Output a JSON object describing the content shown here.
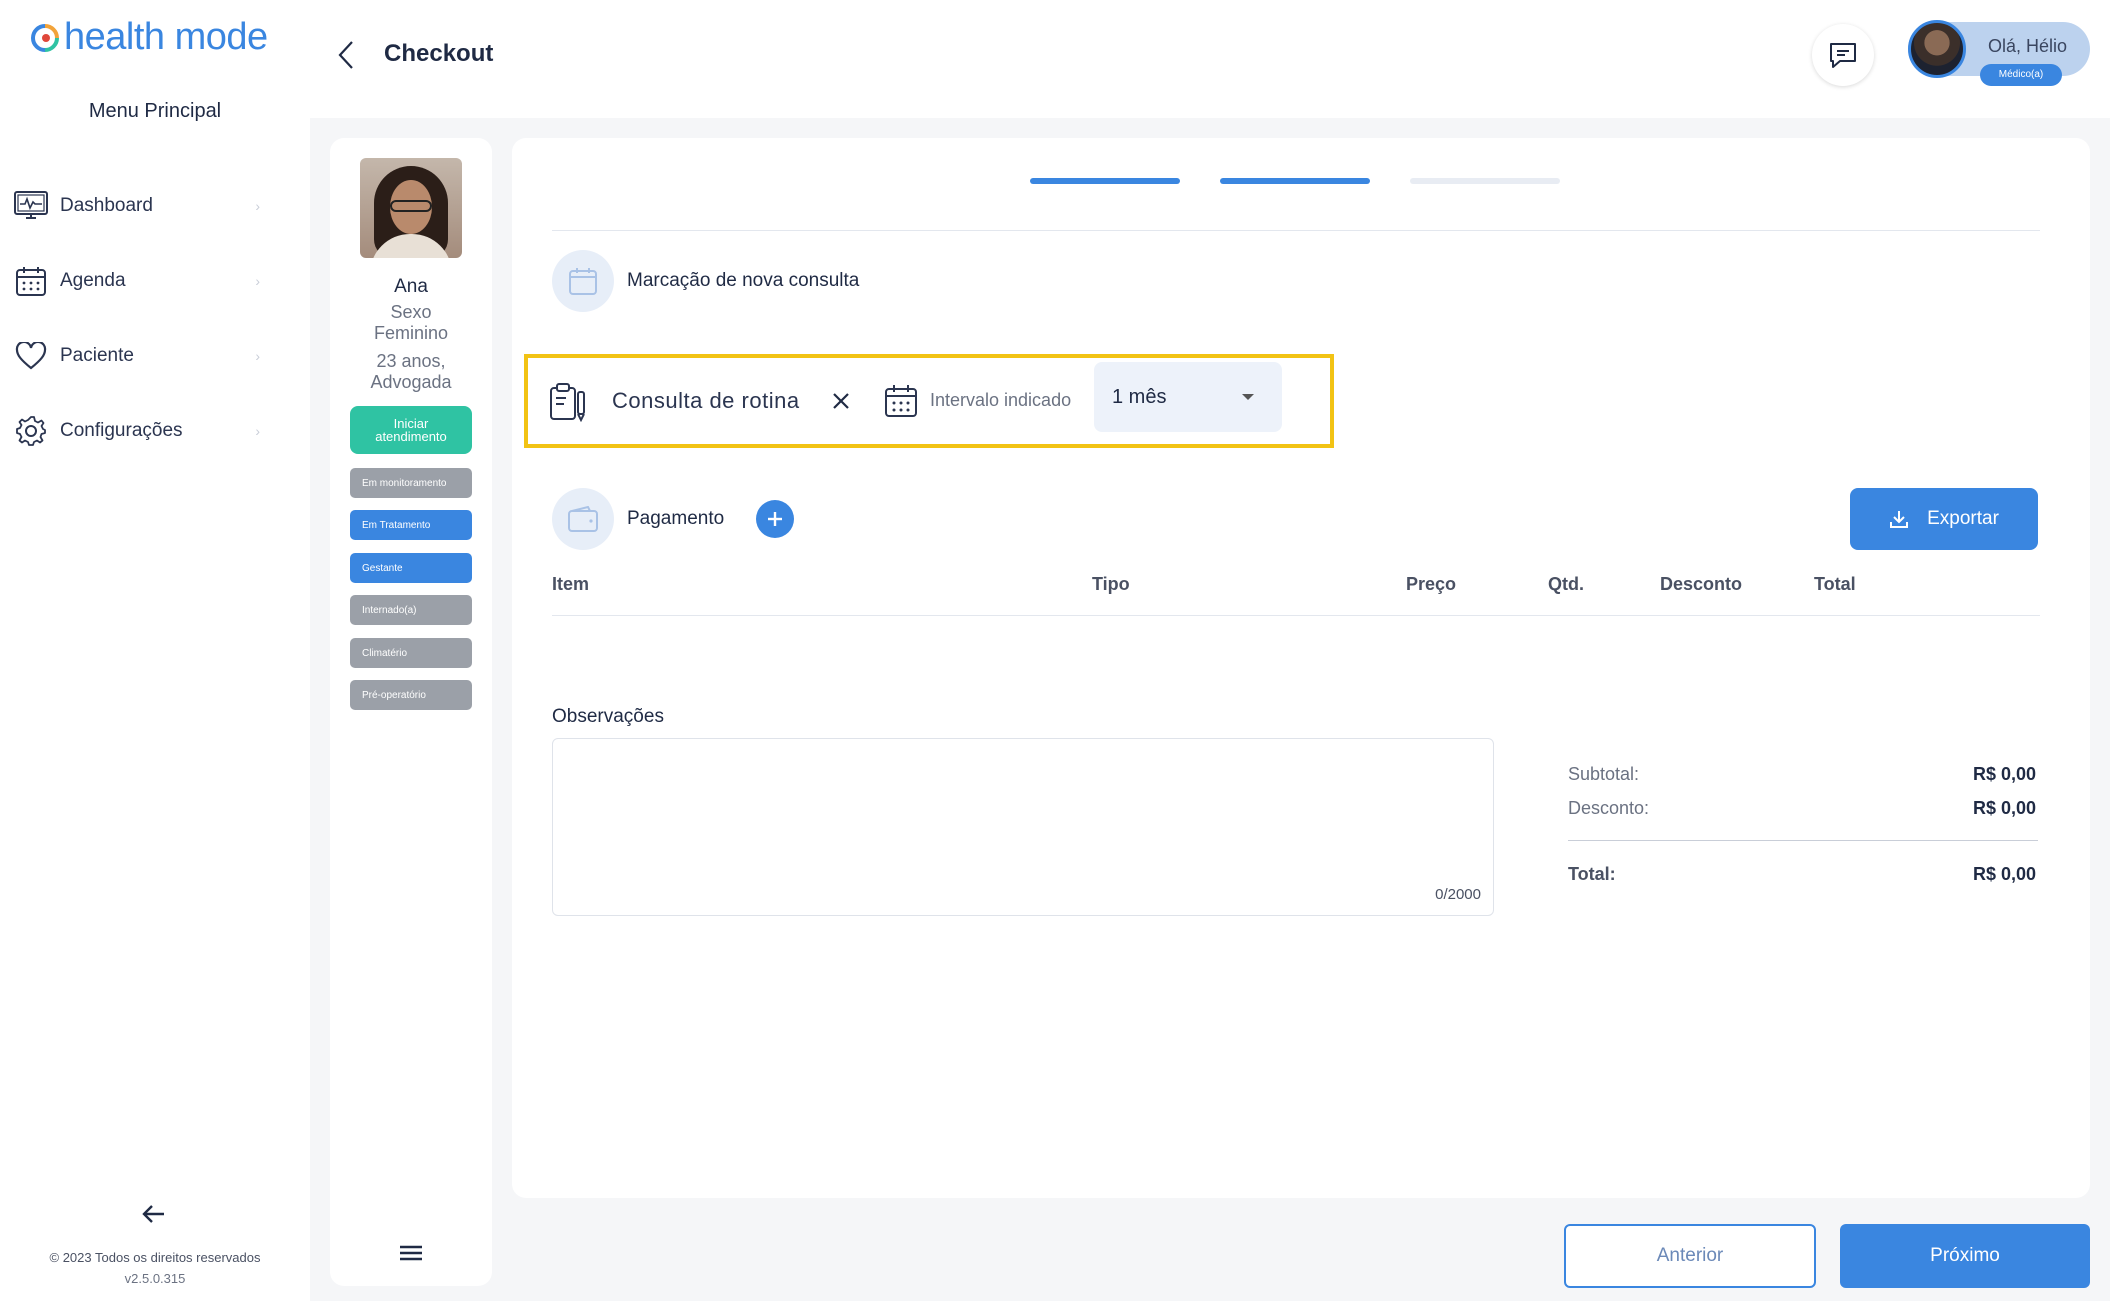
{
  "brand": {
    "name": "health mode",
    "accent": "#3a86e0"
  },
  "sidebar": {
    "menu_title": "Menu Principal",
    "items": [
      {
        "label": "Dashboard",
        "icon": "monitor-icon"
      },
      {
        "label": "Agenda",
        "icon": "calendar-icon"
      },
      {
        "label": "Paciente",
        "icon": "heart-icon"
      },
      {
        "label": "Configurações",
        "icon": "gear-icon"
      }
    ],
    "footer_copyright": "© 2023 Todos os direitos reservados",
    "footer_version": "v2.5.0.315"
  },
  "header": {
    "title": "Checkout",
    "user_greeting": "Olá, Hélio",
    "user_role": "Médico(a)"
  },
  "patient": {
    "name": "Ana",
    "sex_line1": "Sexo",
    "sex_line2": "Feminino",
    "age_line1": "23 anos,",
    "age_line2": "Advogada",
    "start_button": "Iniciar atendimento",
    "tags": [
      {
        "label": "Em monitoramento",
        "color": "#9ba0a8"
      },
      {
        "label": "Em Tratamento",
        "color": "#3a86e0"
      },
      {
        "label": "Gestante",
        "color": "#3a86e0"
      },
      {
        "label": "Internado(a)",
        "color": "#9ba0a8"
      },
      {
        "label": "Climatério",
        "color": "#9ba0a8"
      },
      {
        "label": "Pré-operatório",
        "color": "#9ba0a8"
      }
    ]
  },
  "checkout": {
    "steps_completed": 2,
    "steps_total": 3,
    "new_appointment_title": "Marcação de nova consulta",
    "consultation_type": "Consulta de rotina",
    "interval_label": "Intervalo indicado",
    "interval_value": "1 mês",
    "payment_title": "Pagamento",
    "export_button": "Exportar",
    "table_headers": [
      "Item",
      "Tipo",
      "Preço",
      "Qtd.",
      "Desconto",
      "Total"
    ],
    "observations_label": "Observações",
    "observations_counter": "0/2000",
    "subtotal_label": "Subtotal:",
    "subtotal_value": "R$ 0,00",
    "discount_label": "Desconto:",
    "discount_value": "R$ 0,00",
    "total_label": "Total:",
    "total_value": "R$ 0,00"
  },
  "footer": {
    "prev_button": "Anterior",
    "next_button": "Próximo"
  }
}
